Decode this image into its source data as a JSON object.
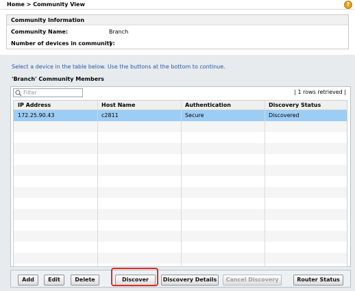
{
  "header": {
    "breadcrumb": "Home > Community View",
    "help_icon": "?"
  },
  "community_info": {
    "title": "Community Information",
    "name_label": "Community Name:",
    "name_value": "Branch",
    "devices_label": "Number of devices in community:",
    "devices_value": "1"
  },
  "instruction": "Select a device in the table below.  Use the buttons at the bottom to continue.",
  "members": {
    "title": "'Branch' Community Members",
    "filter_placeholder": "Filter",
    "retrieved": "| 1 rows retrieved |",
    "columns": [
      "IP Address",
      "Host Name",
      "Authentication",
      "Discovery Status"
    ],
    "rows": [
      {
        "ip": "172.25.90.43",
        "host": "c2811",
        "auth": "Secure",
        "status": "Discovered"
      }
    ]
  },
  "buttons": {
    "add": "Add",
    "edit": "Edit",
    "delete": "Delete",
    "discover": "Discover",
    "discovery_details": "Discovery Details",
    "cancel_discovery": "Cancel Discovery",
    "router_status": "Router Status"
  },
  "colors": {
    "selected_row": "#9ccdf5",
    "instruction_text": "#2a54a7",
    "highlight_box": "#dd2a25"
  }
}
